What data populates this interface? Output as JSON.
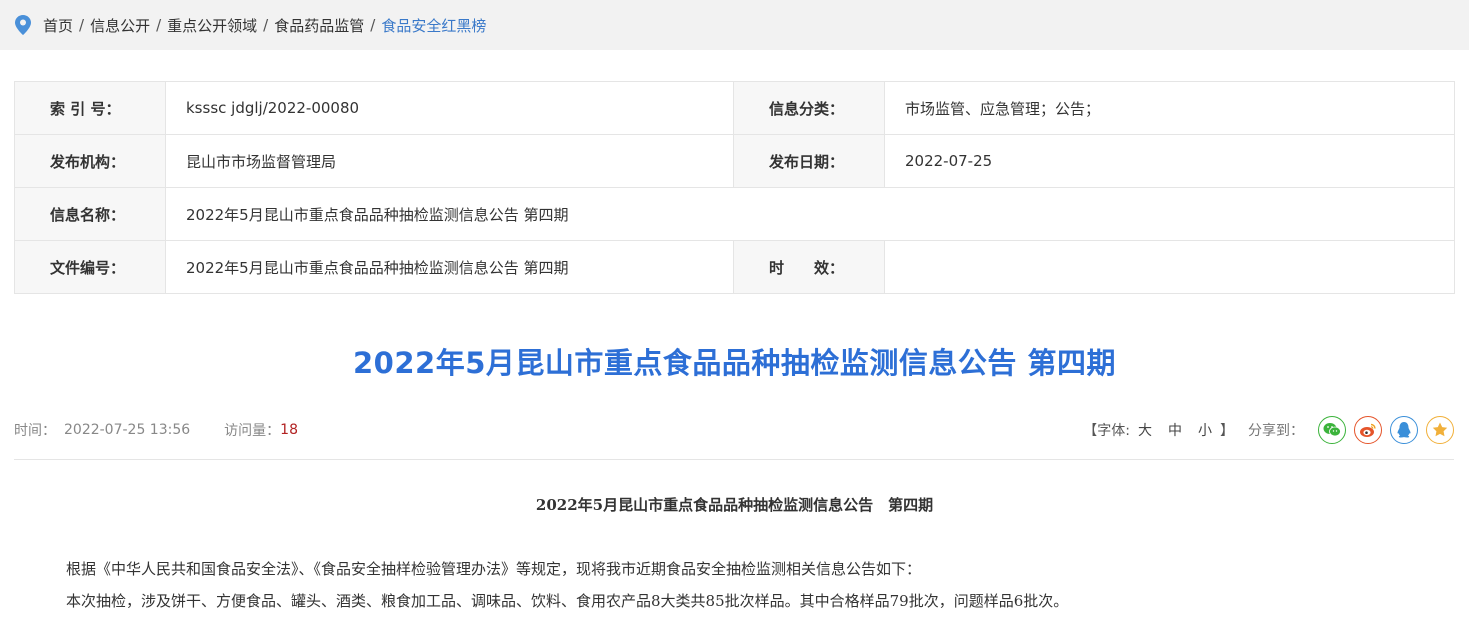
{
  "breadcrumb": {
    "items": [
      "首页",
      "信息公开",
      "重点公开领域",
      "食品药品监管",
      "食品安全红黑榜"
    ],
    "separator": "/"
  },
  "meta": {
    "index_label": "索 引 号：",
    "index_value": "ksssc jdglj/2022-00080",
    "category_label": "信息分类：",
    "category_value": "市场监管、应急管理；公告；",
    "publisher_label": "发布机构：",
    "publisher_value": "昆山市市场监督管理局",
    "date_label": "发布日期：",
    "date_value": "2022-07-25",
    "name_label": "信息名称：",
    "name_value": "2022年5月昆山市重点食品品种抽检监测信息公告 第四期",
    "docno_label": "文件编号：",
    "docno_value": "2022年5月昆山市重点食品品种抽检监测信息公告 第四期",
    "validity_label": "时　　效：",
    "validity_value": ""
  },
  "article": {
    "title": "2022年5月昆山市重点食品品种抽检监测信息公告 第四期",
    "time_label": "时间：",
    "time_value": "2022-07-25 13:56",
    "visits_label": "访问量：",
    "visits_value": "18",
    "font_open": "【字体:",
    "font_large": "大",
    "font_medium": "中",
    "font_small": "小",
    "font_close": "】",
    "share_label": "分享到：",
    "body_title": "2022年5月昆山市重点食品品种抽检监测信息公告　第四期",
    "paragraph_1": "根据《中华人民共和国食品安全法》、《食品安全抽样检验管理办法》等规定，现将我市近期食品安全抽检监测相关信息公告如下：",
    "paragraph_2": "本次抽检，涉及饼干、方便食品、罐头、酒类、粮食加工品、调味品、饮料、食用农产品8大类共85批次样品。其中合格样品79批次，问题样品6批次。"
  },
  "share_icons": [
    "wechat-icon",
    "weibo-icon",
    "qq-icon",
    "qzone-icon"
  ],
  "colors": {
    "accent": "#3a79c9",
    "title": "#2d6fd6",
    "visits": "#b22222"
  }
}
